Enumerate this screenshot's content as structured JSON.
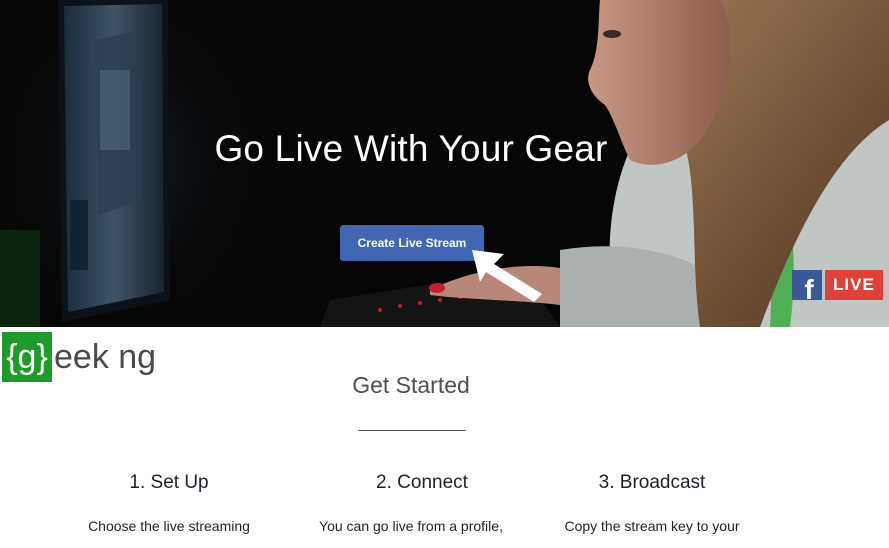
{
  "hero": {
    "title": "Go Live With Your Gear",
    "cta_label": "Create Live Stream",
    "badge_f": "f",
    "badge_live": "LIVE"
  },
  "brand": {
    "box_text": "{g}",
    "text": "eek ng"
  },
  "get_started": {
    "title": "Get Started",
    "steps": [
      {
        "title": "1. Set Up",
        "desc": "Choose the live streaming"
      },
      {
        "title": "2. Connect",
        "desc": "You can go live from a profile,"
      },
      {
        "title": "3. Broadcast",
        "desc": "Copy the stream key to your"
      }
    ]
  },
  "colors": {
    "cta_blue": "#4267b2",
    "facebook_blue": "#3b5998",
    "live_red": "#e0403a",
    "brand_green": "#1e9b2b"
  },
  "icons": [
    "white-arrow-icon",
    "facebook-f-icon"
  ]
}
